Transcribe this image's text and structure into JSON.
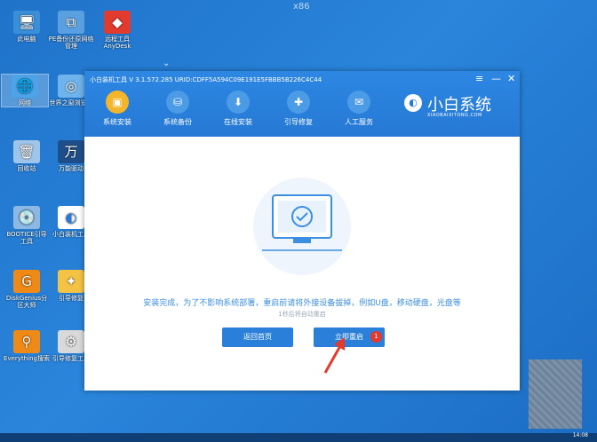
{
  "desktop": {
    "watermark": "x86",
    "icons": [
      {
        "label": "此电脑",
        "icon": "computer-icon",
        "color": "#3a8fd8"
      },
      {
        "label": "PE备份还原网络管理",
        "icon": "network-icon",
        "color": "#5aa0e0"
      },
      {
        "label": "远程工具AnyDesk",
        "icon": "anydesk-icon",
        "color": "#e23b2e"
      },
      {
        "label": "网络",
        "icon": "network-globe-icon",
        "color": "#4da3e8"
      },
      {
        "label": "世界之窗浏览器",
        "icon": "browser-icon",
        "color": "#6fb3ec"
      },
      {
        "label": "回收站",
        "icon": "recycle-bin-icon",
        "color": "#9fc6ea"
      },
      {
        "label": "万能驱动",
        "icon": "driver-icon",
        "color": "#1f4f8a"
      },
      {
        "label": "BOOTICE引导工具",
        "icon": "bootice-icon",
        "color": "#8bb9e3"
      },
      {
        "label": "小白装机工具",
        "icon": "xiaobai-icon",
        "color": "#ffffff"
      },
      {
        "label": "DiskGenius分区大师",
        "icon": "diskgenius-icon",
        "color": "#f08a16"
      },
      {
        "label": "引导修复",
        "icon": "repair-icon",
        "color": "#f4c343"
      },
      {
        "label": "Everything搜索",
        "icon": "search-icon",
        "color": "#f08a16"
      },
      {
        "label": "引导修复工具",
        "icon": "tools-icon",
        "color": "#d9d9d9"
      }
    ]
  },
  "app": {
    "title": "小白装机工具 V 3.1.572.285 URID:CDFF5A594C09E191E5FBBB5B226C4C44",
    "controls": {
      "menu": "≡",
      "minimize": "—",
      "close": "✕"
    },
    "tabs": [
      {
        "label": "系统安装",
        "icon": "system-install-icon",
        "active": true
      },
      {
        "label": "系统备份",
        "icon": "backup-icon",
        "active": false
      },
      {
        "label": "在线安装",
        "icon": "online-install-icon",
        "active": false
      },
      {
        "label": "引导修复",
        "icon": "boot-repair-icon",
        "active": false
      },
      {
        "label": "人工服务",
        "icon": "support-icon",
        "active": false
      }
    ],
    "brand": {
      "name": "小白系统",
      "sub": "XIAOBAIXITONG.COM"
    },
    "message": "安装完成，为了不影响系统部署，重启前请将外接设备拔掉，例如U盘，移动硬盘，光盘等",
    "countdown": "1秒后将自动重启",
    "buttons": {
      "home": "返回首页",
      "restart": "立即重启"
    },
    "badge": "1"
  },
  "taskbar": {
    "time": "14:08"
  }
}
